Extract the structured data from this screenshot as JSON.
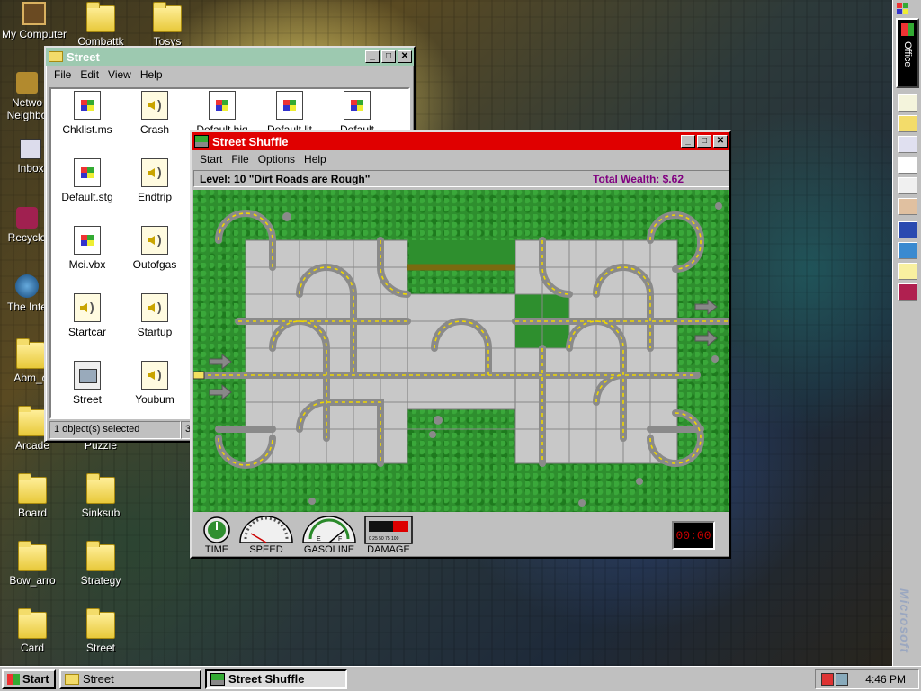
{
  "desktop": {
    "icons": [
      {
        "label": "My Computer",
        "type": "computer"
      },
      {
        "label": "Combattk",
        "type": "folder"
      },
      {
        "label": "Tosys",
        "type": "folder"
      },
      {
        "label": "Network Neighborhood",
        "type": "network",
        "label_lines": [
          "Netwo",
          "Neighbo"
        ]
      },
      {
        "label": "Inbox",
        "type": "inbox"
      },
      {
        "label": "Recycle",
        "type": "recycle"
      },
      {
        "label": "The Inte",
        "type": "internet"
      },
      {
        "label": "Abm_c",
        "type": "folder"
      },
      {
        "label": "Arcade",
        "type": "folder"
      },
      {
        "label": "Puzzle",
        "type": "folder"
      },
      {
        "label": "Board",
        "type": "folder"
      },
      {
        "label": "Sinksub",
        "type": "folder"
      },
      {
        "label": "Bow_arro",
        "type": "folder"
      },
      {
        "label": "Strategy",
        "type": "folder"
      },
      {
        "label": "Card",
        "type": "folder"
      },
      {
        "label": "Street",
        "type": "folder"
      }
    ],
    "watermark": "Microsoft"
  },
  "street_window": {
    "title": "Street",
    "menu": [
      "File",
      "Edit",
      "View",
      "Help"
    ],
    "files": [
      {
        "name": "Chklist.ms",
        "icon": "doc-icon"
      },
      {
        "name": "Crash",
        "icon": "sound-icon"
      },
      {
        "name": "Default.hig",
        "icon": "doc-icon"
      },
      {
        "name": "Default.lit",
        "icon": "doc-icon"
      },
      {
        "name": "Default",
        "icon": "doc-icon"
      },
      {
        "name": "Default.stg",
        "icon": "doc-icon"
      },
      {
        "name": "Endtrip",
        "icon": "sound-icon"
      },
      {
        "name": "Mci.vbx",
        "icon": "doc-icon"
      },
      {
        "name": "Outofgas",
        "icon": "sound-icon"
      },
      {
        "name": "Startcar",
        "icon": "sound-icon"
      },
      {
        "name": "Startup",
        "icon": "sound-icon"
      },
      {
        "name": "Street",
        "icon": "exe-icon"
      },
      {
        "name": "Youbum",
        "icon": "sound-icon"
      }
    ],
    "status_left": "1 object(s) selected",
    "status_right": "3"
  },
  "game_window": {
    "title": "Street Shuffle",
    "menu": [
      "Start",
      "File",
      "Options",
      "Help"
    ],
    "level_text": "Level: 10  \"Dirt Roads are Rough\"",
    "wealth_text": "Total Wealth: $.62",
    "gauges": {
      "time_label": "TIME",
      "speed_label": "SPEED",
      "gasoline_label": "GASOLINE",
      "damage_label": "DAMAGE",
      "gas_e": "E",
      "gas_f": "F",
      "damage_ticks": "0 25 50 75 100"
    },
    "timer": "00:00"
  },
  "officebar": {
    "label": "Office",
    "tools": [
      "new-document-icon",
      "open-folder-icon",
      "message-icon",
      "appointment-icon",
      "task-icon",
      "contact-icon",
      "microsoft-network-icon",
      "internet-icon",
      "help-icon",
      "book-icon"
    ]
  },
  "taskbar": {
    "start_label": "Start",
    "buttons": [
      {
        "label": "Street",
        "active": false
      },
      {
        "label": "Street Shuffle",
        "active": true
      }
    ],
    "clock": "4:46 PM"
  },
  "colors": {
    "game_title": "#e00000",
    "explorer_title": "#9dc9b0",
    "road": "#8a8a8a",
    "road_line": "#f0d800",
    "grass": "#2e8f2e",
    "tile": "#c8c8c8"
  }
}
